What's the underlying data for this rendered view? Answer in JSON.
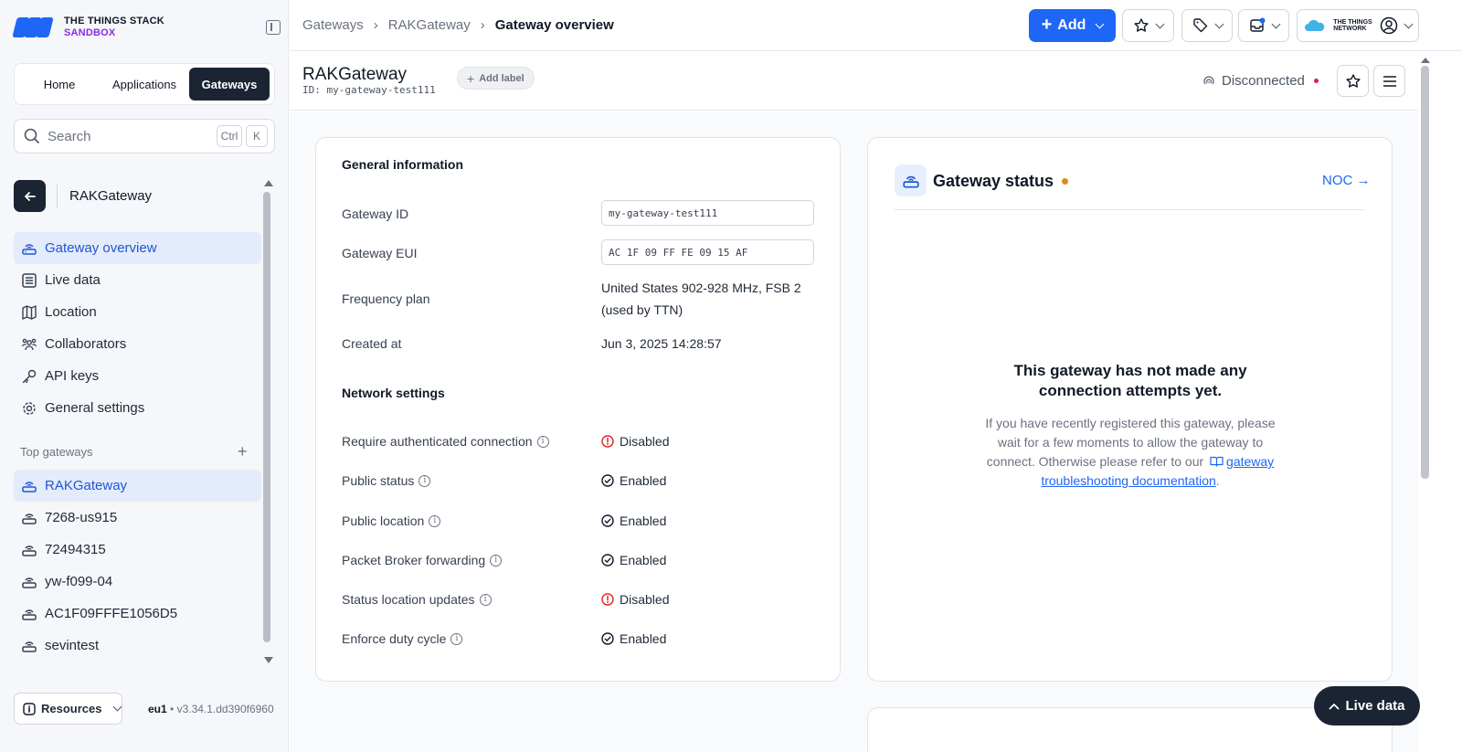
{
  "brand": {
    "line1": "THE THINGS STACK",
    "line2": "SANDBOX"
  },
  "top_tabs": [
    {
      "label": "Home"
    },
    {
      "label": "Applications"
    },
    {
      "label": "Gateways",
      "active": true
    }
  ],
  "search": {
    "placeholder": "Search",
    "kbd1": "Ctrl",
    "kbd2": "K"
  },
  "entity": {
    "name": "RAKGateway"
  },
  "nav": [
    {
      "label": "Gateway overview",
      "icon": "gateway-icon",
      "active": true
    },
    {
      "label": "Live data",
      "icon": "list-icon"
    },
    {
      "label": "Location",
      "icon": "map-icon"
    },
    {
      "label": "Collaborators",
      "icon": "users-icon"
    },
    {
      "label": "API keys",
      "icon": "key-icon"
    },
    {
      "label": "General settings",
      "icon": "gear-icon"
    }
  ],
  "top_gateways": {
    "heading": "Top gateways",
    "items": [
      {
        "label": "RAKGateway",
        "active": true
      },
      {
        "label": "7268-us915"
      },
      {
        "label": "72494315"
      },
      {
        "label": "yw-f099-04"
      },
      {
        "label": "AC1F09FFFE1056D5"
      },
      {
        "label": "sevintest"
      }
    ]
  },
  "footer": {
    "resources": "Resources",
    "region": "eu1",
    "version": "v3.34.1.dd390f6960"
  },
  "breadcrumbs": [
    "Gateways",
    "RAKGateway",
    "Gateway overview"
  ],
  "header": {
    "add": "Add"
  },
  "title_bar": {
    "title": "RAKGateway",
    "id": "ID: my-gateway-test111",
    "add_label": "Add label",
    "status": "Disconnected"
  },
  "general": {
    "heading": "General information",
    "gateway_id_label": "Gateway ID",
    "gateway_id": "my-gateway-test111",
    "eui_label": "Gateway EUI",
    "eui": "AC 1F 09 FF FE 09 15 AF",
    "freq_label": "Frequency plan",
    "freq_line1": "United States 902-928 MHz, FSB 2",
    "freq_line2": "(used by TTN)",
    "created_label": "Created at",
    "created": "Jun 3, 2025 14:28:57"
  },
  "network": {
    "heading": "Network settings",
    "rows": [
      {
        "label": "Require authenticated connection",
        "value": "Disabled",
        "state": "off"
      },
      {
        "label": "Public status",
        "value": "Enabled",
        "state": "on"
      },
      {
        "label": "Public location",
        "value": "Enabled",
        "state": "on"
      },
      {
        "label": "Packet Broker forwarding",
        "value": "Enabled",
        "state": "on"
      },
      {
        "label": "Status location updates",
        "value": "Disabled",
        "state": "off"
      },
      {
        "label": "Enforce duty cycle",
        "value": "Enabled",
        "state": "on"
      }
    ]
  },
  "status_card": {
    "title": "Gateway status",
    "noc": "NOC →",
    "empty_title": "This gateway has not made any connection attempts yet.",
    "empty_body": "If you have recently registered this gateway, please wait for a few moments to allow the gateway to connect. Otherwise please refer to our",
    "link": "gateway troubleshooting documentation",
    "link_end": "."
  },
  "live_data_button": "Live data",
  "colors": {
    "accent": "#1e66f5",
    "dark": "#1b2433",
    "disabled": "#dc2626",
    "status_dot": "#e08a1f"
  }
}
